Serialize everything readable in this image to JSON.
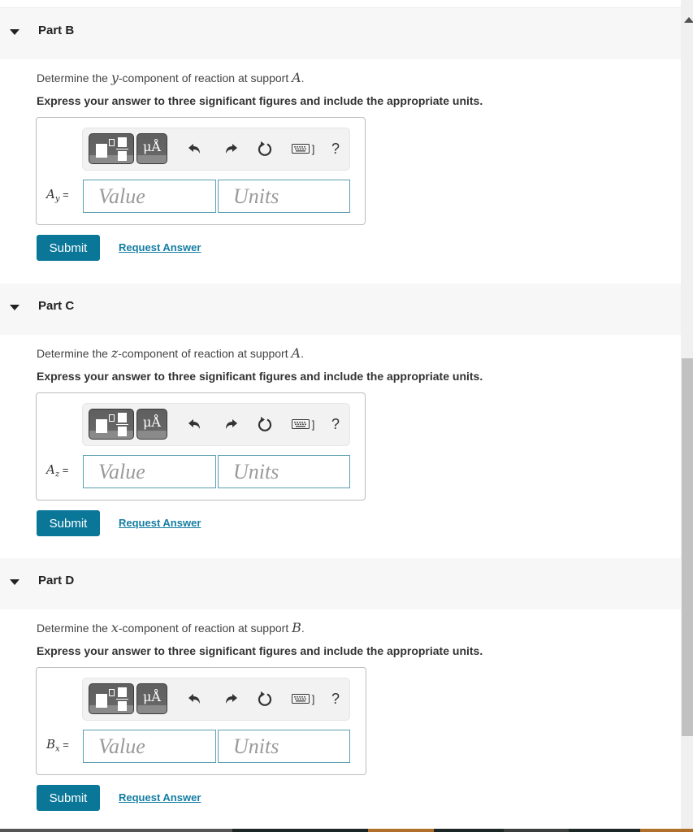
{
  "colors": {
    "accent": "#0a7799",
    "link": "#137da3",
    "field_border": "#5a9fb1",
    "header_bg": "#f7f7f7",
    "toolbar_button": "#5f5f5f"
  },
  "toolbar": {
    "templates_icon": "templates-icon",
    "units_label": "μÅ",
    "undo_icon": "undo-icon",
    "redo_icon": "redo-icon",
    "reset_icon": "reset-icon",
    "keyboard_icon": "keyboard-icon",
    "keyboard_suffix": "]",
    "help_label": "?"
  },
  "parts": [
    {
      "title": "Part B",
      "question_prefix": "Determine the ",
      "question_var": "y",
      "question_mid": "-component of reaction at support ",
      "question_support": "A",
      "question_suffix": ".",
      "instruction": "Express your answer to three significant figures and include the appropriate units.",
      "var_main": "A",
      "var_sub": "y",
      "equals": " =",
      "value_placeholder": "Value",
      "units_placeholder": "Units",
      "value": "",
      "units": "",
      "submit_label": "Submit",
      "request_label": "Request Answer"
    },
    {
      "title": "Part C",
      "question_prefix": "Determine the ",
      "question_var": "z",
      "question_mid": "-component of reaction at support ",
      "question_support": "A",
      "question_suffix": ".",
      "instruction": "Express your answer to three significant figures and include the appropriate units.",
      "var_main": "A",
      "var_sub": "z",
      "equals": " =",
      "value_placeholder": "Value",
      "units_placeholder": "Units",
      "value": "",
      "units": "",
      "submit_label": "Submit",
      "request_label": "Request Answer"
    },
    {
      "title": "Part D",
      "question_prefix": "Determine the ",
      "question_var": "x",
      "question_mid": "-component of reaction at support ",
      "question_support": "B",
      "question_suffix": ".",
      "instruction": "Express your answer to three significant figures and include the appropriate units.",
      "var_main": "B",
      "var_sub": "x",
      "equals": " =",
      "value_placeholder": "Value",
      "units_placeholder": "Units",
      "value": "",
      "units": "",
      "submit_label": "Submit",
      "request_label": "Request Answer"
    }
  ]
}
